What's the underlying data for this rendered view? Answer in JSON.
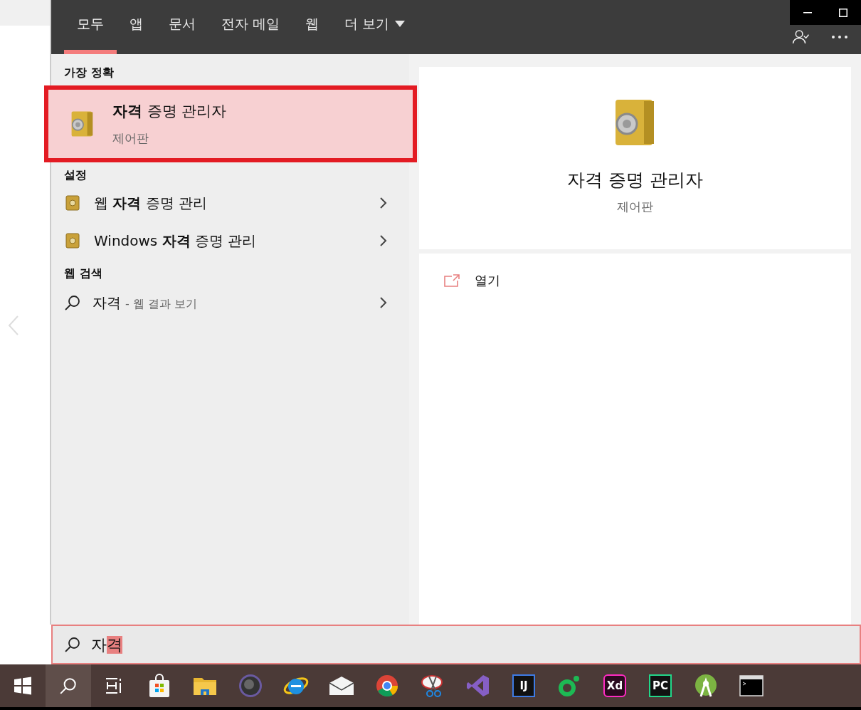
{
  "tabs": [
    {
      "label": "모두",
      "selected": true
    },
    {
      "label": "앱",
      "selected": false
    },
    {
      "label": "문서",
      "selected": false
    },
    {
      "label": "전자 메일",
      "selected": false
    },
    {
      "label": "웹",
      "selected": false
    },
    {
      "label": "더 보기",
      "selected": false,
      "kind": "dropdown"
    }
  ],
  "best_match": {
    "heading": "가장 정확",
    "title": "**자격** 증명 관리자",
    "subtitle": "제어판",
    "selected": true
  },
  "settings": {
    "heading": "설정",
    "items": [
      {
        "label": "웹 **자격** 증명 관리"
      },
      {
        "label": "Windows **자격** 증명 관리"
      }
    ]
  },
  "web_search": {
    "heading": "웹 검색",
    "query": "자격",
    "hint": "- 웹 결과 보기"
  },
  "preview": {
    "title": "자격 증명 관리자",
    "subtitle": "제어판",
    "actions": [
      {
        "label": "열기"
      }
    ]
  },
  "search_box": {
    "value": "자",
    "composing": "격"
  },
  "taskbar": [
    {
      "kind": "start"
    },
    {
      "kind": "search",
      "selected": true
    },
    {
      "kind": "taskview"
    },
    {
      "kind": "store"
    },
    {
      "kind": "folder"
    },
    {
      "kind": "dial"
    },
    {
      "kind": "ie"
    },
    {
      "kind": "mail"
    },
    {
      "kind": "chrome"
    },
    {
      "kind": "scissors"
    },
    {
      "kind": "vs"
    },
    {
      "kind": "tile",
      "label": "IJ"
    },
    {
      "kind": "ring"
    },
    {
      "kind": "tile",
      "label": "Xd"
    },
    {
      "kind": "tile",
      "label": "PC"
    },
    {
      "kind": "android"
    },
    {
      "kind": "terminal"
    }
  ]
}
